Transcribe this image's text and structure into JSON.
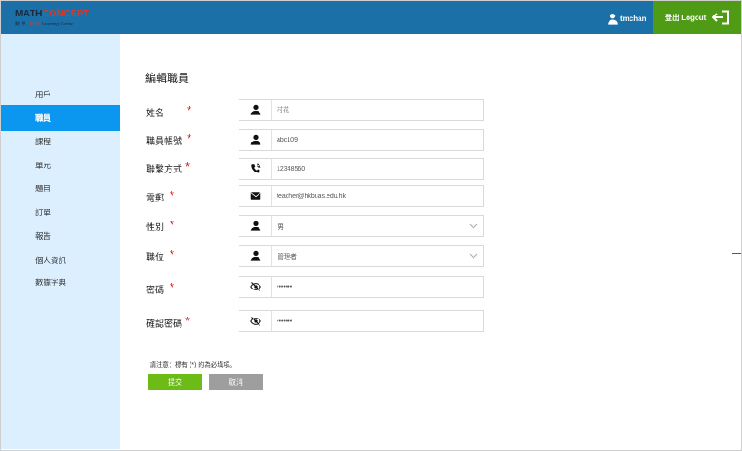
{
  "header": {
    "logo_main_1": "MATH",
    "logo_main_2": "CONCEPT",
    "logo_sub_1": "數 學 · ",
    "logo_sub_2": "概 念",
    "logo_sub_3": " Learning Center",
    "username": "tmchan",
    "logout_label": "登出 Logout"
  },
  "sidebar": {
    "items": [
      {
        "label": "用戶"
      },
      {
        "label": "職員"
      },
      {
        "label": "課程"
      },
      {
        "label": "單元"
      },
      {
        "label": "題目"
      },
      {
        "label": "訂單"
      },
      {
        "label": "報告"
      },
      {
        "label": "個人資訊"
      },
      {
        "label": "數據字典"
      }
    ],
    "active_index": 1
  },
  "form": {
    "title": "編輯職員",
    "required_mark": "*",
    "fields": {
      "name": {
        "label": "姓名",
        "placeholder": "村花",
        "icon": "person-icon"
      },
      "account": {
        "label": "職員帳號",
        "value": "abc109",
        "icon": "person-icon"
      },
      "contact": {
        "label": "聯繫方式",
        "value": "12348560",
        "icon": "phone-icon"
      },
      "email": {
        "label": "電郵",
        "value": "teacher@hkbuas.edu.hk",
        "icon": "envelope-icon"
      },
      "gender": {
        "label": "性別",
        "value": "男",
        "icon": "person-icon"
      },
      "position": {
        "label": "職位",
        "value": "管理者",
        "icon": "person-icon"
      },
      "password": {
        "label": "密碼",
        "value": "•••••••",
        "icon": "eye-slash-icon"
      },
      "confirm_password": {
        "label": "確認密碼",
        "value": "•••••••",
        "icon": "eye-slash-icon"
      }
    },
    "note": "請注意：標有 (*) 的為必填項。",
    "submit_label": "提交",
    "cancel_label": "取消"
  },
  "colors": {
    "header_bg": "#1c70a8",
    "logout_bg": "#4f9b16",
    "sidebar_bg": "#dcefff",
    "active_nav": "#0b97ef",
    "submit_bg": "#6cbb17",
    "cancel_bg": "#9e9e9e",
    "required": "#e21c1c"
  }
}
